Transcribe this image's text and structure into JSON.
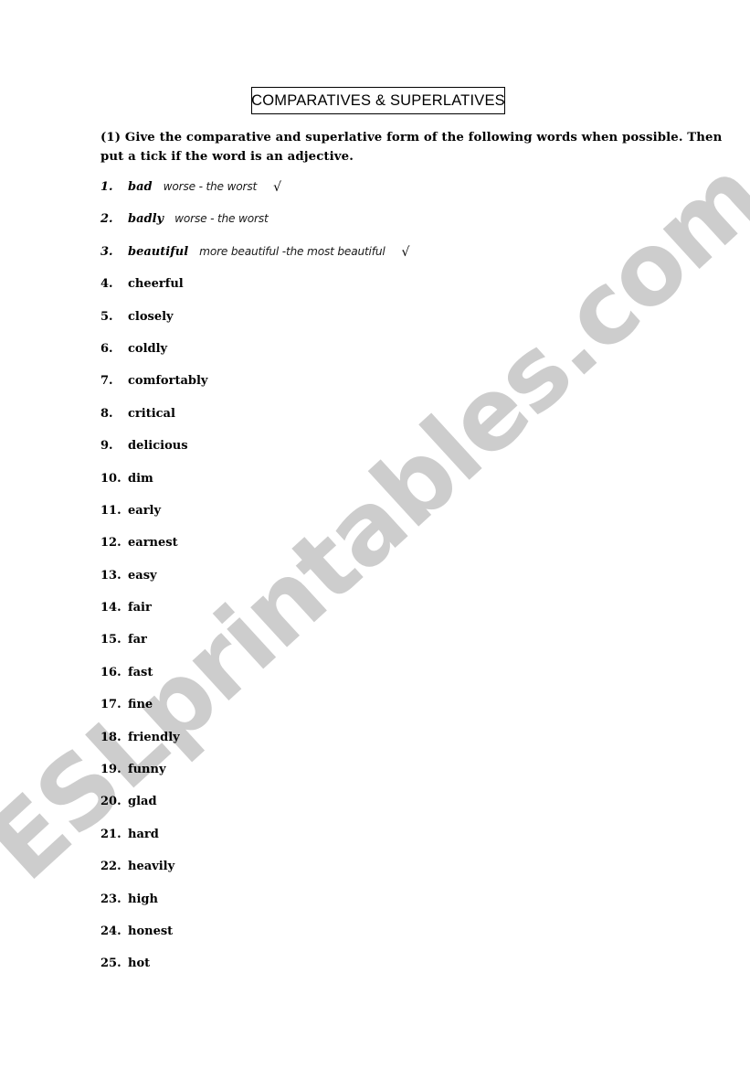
{
  "page": {
    "background_color": "#ffffff"
  },
  "watermark": {
    "text": "ESLprintables.com",
    "color": "#cdcdcd"
  },
  "title": {
    "text": "COMPARATIVES & SUPERLATIVES"
  },
  "instructions": {
    "line1": "(1) Give the comparative and superlative form of the following words when possible. Then",
    "line2": "put a tick if the word is an adjective."
  },
  "word_list": {
    "tick_mark": "√",
    "items": [
      {
        "num": "1.",
        "word": "bad",
        "answer": "worse - the worst",
        "tick": "√"
      },
      {
        "num": "2.",
        "word": "badly",
        "answer": "worse - the worst",
        "tick": ""
      },
      {
        "num": "3.",
        "word": "beautiful",
        "answer": "more beautiful -the most beautiful",
        "tick": "√"
      },
      {
        "num": "4.",
        "word": "cheerful",
        "answer": "",
        "tick": ""
      },
      {
        "num": "5.",
        "word": "closely",
        "answer": "",
        "tick": ""
      },
      {
        "num": "6.",
        "word": "coldly",
        "answer": "",
        "tick": ""
      },
      {
        "num": "7.",
        "word": "comfortably",
        "answer": "",
        "tick": ""
      },
      {
        "num": "8.",
        "word": "critical",
        "answer": "",
        "tick": ""
      },
      {
        "num": "9.",
        "word": "delicious",
        "answer": "",
        "tick": ""
      },
      {
        "num": "10.",
        "word": "dim",
        "answer": "",
        "tick": ""
      },
      {
        "num": "11.",
        "word": "early",
        "answer": "",
        "tick": ""
      },
      {
        "num": "12.",
        "word": "earnest",
        "answer": "",
        "tick": ""
      },
      {
        "num": "13.",
        "word": "easy",
        "answer": "",
        "tick": ""
      },
      {
        "num": "14.",
        "word": "fair",
        "answer": "",
        "tick": ""
      },
      {
        "num": "15.",
        "word": "far",
        "answer": "",
        "tick": ""
      },
      {
        "num": "16.",
        "word": "fast",
        "answer": "",
        "tick": ""
      },
      {
        "num": "17.",
        "word": "fine",
        "answer": "",
        "tick": ""
      },
      {
        "num": "18.",
        "word": "friendly",
        "answer": "",
        "tick": ""
      },
      {
        "num": "19.",
        "word": "funny",
        "answer": "",
        "tick": ""
      },
      {
        "num": "20.",
        "word": "glad",
        "answer": "",
        "tick": ""
      },
      {
        "num": "21.",
        "word": "hard",
        "answer": "",
        "tick": ""
      },
      {
        "num": "22.",
        "word": "heavily",
        "answer": "",
        "tick": ""
      },
      {
        "num": "23.",
        "word": "high",
        "answer": "",
        "tick": ""
      },
      {
        "num": "24.",
        "word": "honest",
        "answer": "",
        "tick": ""
      },
      {
        "num": "25.",
        "word": "hot",
        "answer": "",
        "tick": ""
      }
    ]
  }
}
